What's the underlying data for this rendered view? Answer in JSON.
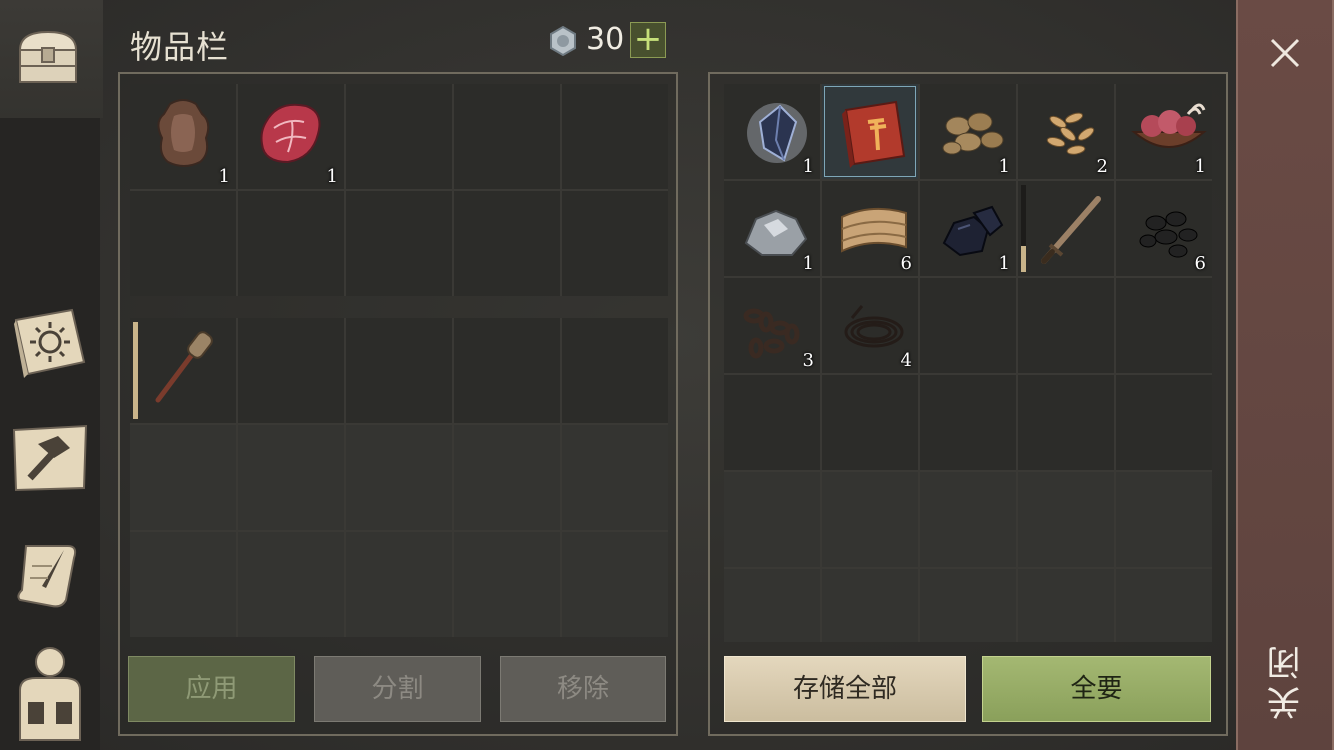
{
  "header": {
    "title": "物品栏",
    "currency_value": "30",
    "currency_add": "+"
  },
  "inventory": {
    "rows": [
      [
        {
          "icon": "hide-icon",
          "qty": "1"
        },
        {
          "icon": "raw-meat-icon",
          "qty": "1"
        },
        {},
        {},
        {}
      ],
      [
        {},
        {},
        {},
        {},
        {}
      ]
    ],
    "equipment_rows": [
      [
        {
          "icon": "stone-club-icon",
          "durability": 1.0
        },
        {},
        {},
        {},
        {}
      ],
      [
        {},
        {},
        {},
        {},
        {}
      ],
      [
        {},
        {},
        {},
        {},
        {}
      ]
    ]
  },
  "storage": {
    "rows": [
      [
        {
          "icon": "crystal-icon",
          "qty": "1"
        },
        {
          "icon": "recipe-book-icon",
          "selected": true
        },
        {
          "icon": "potatoes-icon",
          "qty": "1"
        },
        {
          "icon": "wheat-seeds-icon",
          "qty": "2"
        },
        {
          "icon": "meat-bowl-icon",
          "qty": "1"
        }
      ],
      [
        {
          "icon": "iron-ore-icon",
          "qty": "1"
        },
        {
          "icon": "leather-icon",
          "qty": "6"
        },
        {
          "icon": "coal-icon",
          "qty": "1"
        },
        {
          "icon": "sword-icon",
          "durability": 0.3
        },
        {
          "icon": "black-stones-icon",
          "qty": "6"
        }
      ],
      [
        {
          "icon": "chain-icon",
          "qty": "3"
        },
        {
          "icon": "wire-icon",
          "qty": "4"
        },
        {},
        {},
        {}
      ],
      [
        {},
        {},
        {},
        {},
        {}
      ],
      [
        {},
        {},
        {},
        {},
        {}
      ],
      [
        {},
        {},
        {},
        {},
        {}
      ]
    ]
  },
  "buttons": {
    "apply": "应用",
    "split": "分割",
    "remove": "移除",
    "store_all": "存储全部",
    "take_all": "全要"
  },
  "close": {
    "label": "关闭"
  },
  "colors": {
    "accent_green": "#8aa05b",
    "close_column": "#6a4b45",
    "durability_fill": "#c9b48a"
  }
}
